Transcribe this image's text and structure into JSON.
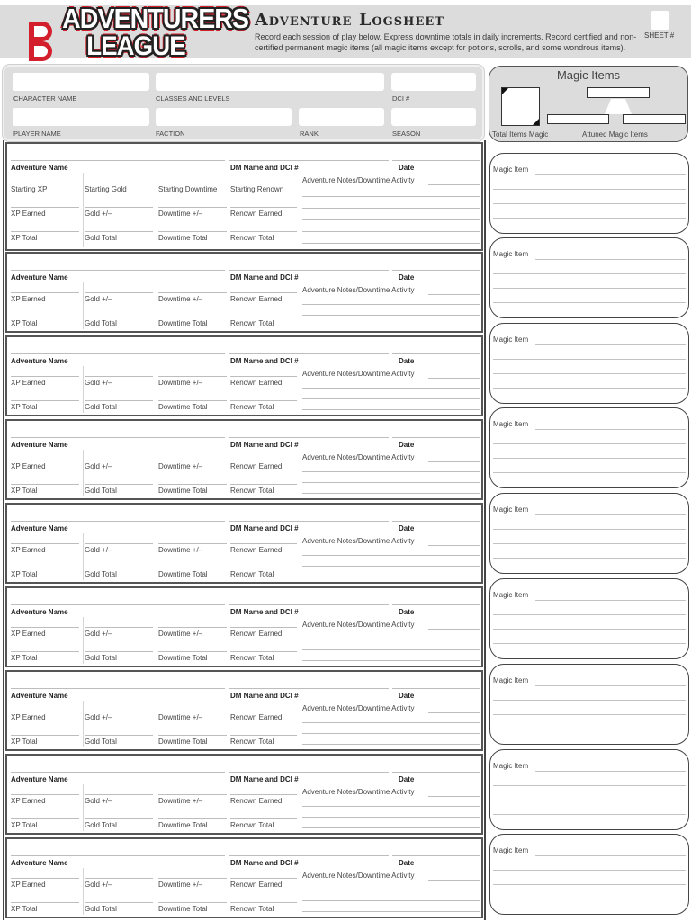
{
  "header": {
    "logo_line1": "ADVENTURERS",
    "logo_line2": "LEAGUE",
    "logo_emblem": "D&D",
    "title": "Adventure Logsheet",
    "description": "Record each session of play below. Express downtime totals in daily increments. Record certified and non-certified permanent magic items (all magic items except for potions, scrolls, and some wondrous items).",
    "sheet_label": "SHEET #",
    "sheet_value": ""
  },
  "character": {
    "fields": [
      {
        "label": "CHARACTER NAME",
        "value": ""
      },
      {
        "label": "CLASSES AND LEVELS",
        "value": ""
      },
      {
        "label": "DCI #",
        "value": ""
      },
      {
        "label": "PLAYER NAME",
        "value": ""
      },
      {
        "label": "FACTION",
        "value": ""
      },
      {
        "label": "RANK",
        "value": ""
      },
      {
        "label": "SEASON",
        "value": ""
      }
    ]
  },
  "magic_summary": {
    "title": "Magic Items",
    "total_label": "Total Items Magic",
    "attuned_label": "Attuned Magic Items",
    "total_value": "",
    "attuned_values": [
      "",
      "",
      ""
    ]
  },
  "adventure_labels": {
    "adventure_name": "Adventure Name",
    "dm": "DM Name and DCI #",
    "date": "Date",
    "notes": "Adventure Notes/Downtime Activity",
    "starting_xp": "Starting XP",
    "starting_gold": "Starting Gold",
    "starting_downtime": "Starting Downtime",
    "starting_renown": "Starting Renown",
    "xp_earned": "XP Earned",
    "gold_change": "Gold +/–",
    "downtime_change": "Downtime +/–",
    "renown_earned": "Renown Earned",
    "xp_total": "XP Total",
    "gold_total": "Gold Total",
    "downtime_total": "Downtime Total",
    "renown_total": "Renown Total"
  },
  "adventures": [
    {
      "has_starting_row": true
    },
    {
      "has_starting_row": false
    },
    {
      "has_starting_row": false
    },
    {
      "has_starting_row": false
    },
    {
      "has_starting_row": false
    },
    {
      "has_starting_row": false
    },
    {
      "has_starting_row": false
    },
    {
      "has_starting_row": false
    },
    {
      "has_starting_row": false
    }
  ],
  "magic_item_cards": {
    "label": "Magic Item",
    "count": 9
  }
}
